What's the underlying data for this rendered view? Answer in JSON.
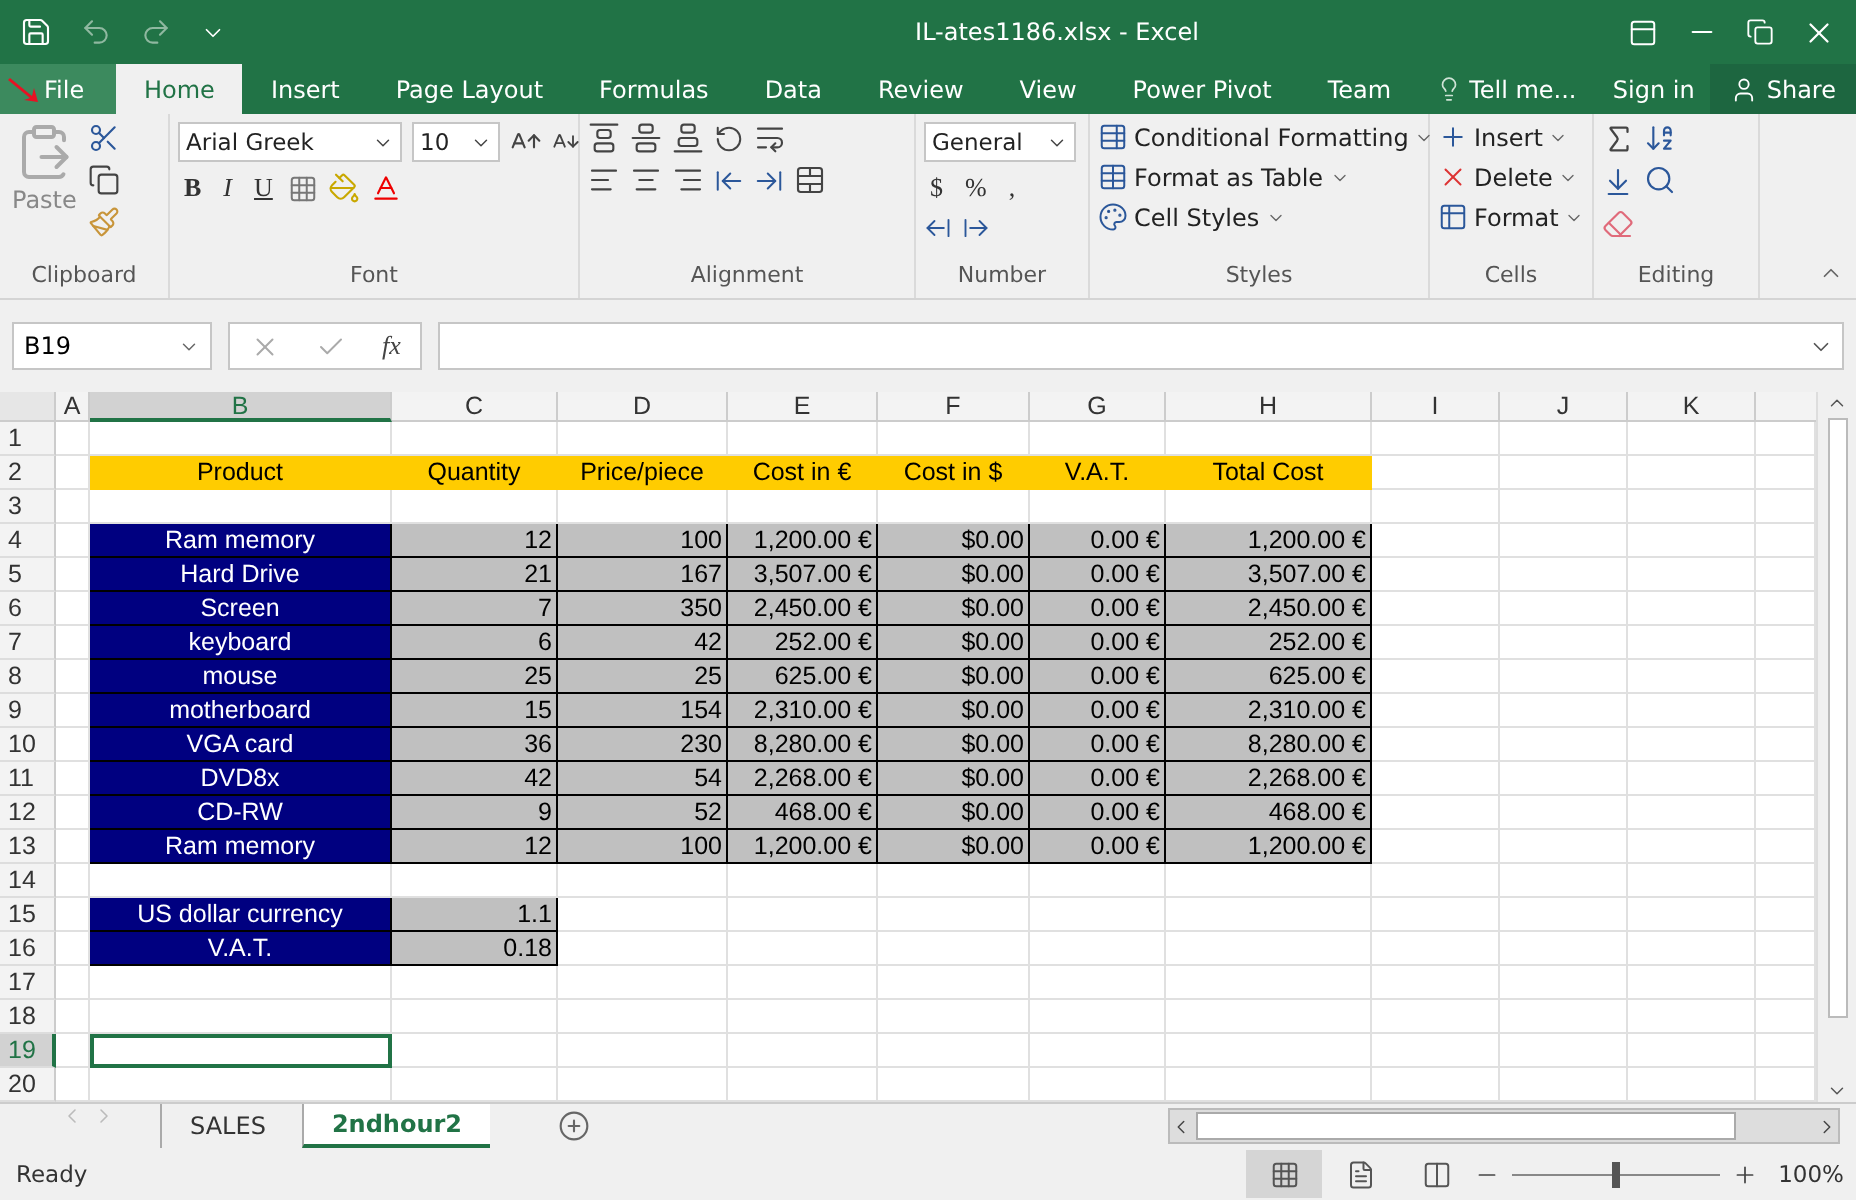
{
  "window": {
    "title": "IL-ates1186.xlsx - Excel"
  },
  "menu_tabs": [
    {
      "label": "File",
      "kind": "file",
      "selected": false
    },
    {
      "label": "Home",
      "kind": "tab",
      "selected": true
    },
    {
      "label": "Insert",
      "kind": "tab",
      "selected": false
    },
    {
      "label": "Page Layout",
      "kind": "tab",
      "selected": false
    },
    {
      "label": "Formulas",
      "kind": "tab",
      "selected": false
    },
    {
      "label": "Data",
      "kind": "tab",
      "selected": false
    },
    {
      "label": "Review",
      "kind": "tab",
      "selected": false
    },
    {
      "label": "View",
      "kind": "tab",
      "selected": false
    },
    {
      "label": "Power Pivot",
      "kind": "tab",
      "selected": false
    },
    {
      "label": "Team",
      "kind": "tab",
      "selected": false
    }
  ],
  "tell_me": "Tell me...",
  "sign_in": "Sign in",
  "share": "Share",
  "ribbon": {
    "paste": "Paste",
    "font_name": "Arial Greek",
    "font_size": "10",
    "font_buttons": [
      "B",
      "I",
      "U"
    ],
    "number_format": "General",
    "number_buttons": [
      "$",
      "%",
      ","
    ],
    "styles": [
      "Conditional Formatting",
      "Format as Table",
      "Cell Styles"
    ],
    "cells": [
      "Insert",
      "Delete",
      "Format"
    ],
    "groups": [
      "Clipboard",
      "Font",
      "Alignment",
      "Number",
      "Styles",
      "Cells",
      "Editing"
    ]
  },
  "formula_bar": {
    "name_box": "B19",
    "fx": "fx"
  },
  "sheet": {
    "columns": [
      {
        "label": "A",
        "selected": false
      },
      {
        "label": "B",
        "selected": true
      },
      {
        "label": "C",
        "selected": false
      },
      {
        "label": "D",
        "selected": false
      },
      {
        "label": "E",
        "selected": false
      },
      {
        "label": "F",
        "selected": false
      },
      {
        "label": "G",
        "selected": false
      },
      {
        "label": "H",
        "selected": false
      },
      {
        "label": "I",
        "selected": false
      },
      {
        "label": "J",
        "selected": false
      },
      {
        "label": "K",
        "selected": false
      }
    ],
    "rows": [
      {
        "number": "1",
        "selected": false,
        "cells": [
          {
            "kind": "empty"
          },
          {
            "kind": "empty"
          },
          {
            "kind": "empty"
          },
          {
            "kind": "empty"
          },
          {
            "kind": "empty"
          },
          {
            "kind": "empty"
          },
          {
            "kind": "empty"
          },
          {
            "kind": "empty"
          },
          {
            "kind": "empty"
          },
          {
            "kind": "empty"
          },
          {
            "kind": "empty"
          }
        ]
      },
      {
        "number": "2",
        "selected": false,
        "cells": [
          {
            "kind": "empty"
          },
          {
            "kind": "heading",
            "text": "Product"
          },
          {
            "kind": "heading",
            "text": "Quantity"
          },
          {
            "kind": "heading",
            "text": "Price/piece"
          },
          {
            "kind": "heading",
            "text": "Cost in €"
          },
          {
            "kind": "heading",
            "text": "Cost in $"
          },
          {
            "kind": "heading",
            "text": "V.A.T."
          },
          {
            "kind": "heading",
            "text": "Total Cost"
          },
          {
            "kind": "empty"
          },
          {
            "kind": "empty"
          },
          {
            "kind": "empty"
          }
        ]
      },
      {
        "number": "3",
        "selected": false,
        "cells": [
          {
            "kind": "empty"
          },
          {
            "kind": "empty"
          },
          {
            "kind": "empty"
          },
          {
            "kind": "empty"
          },
          {
            "kind": "empty"
          },
          {
            "kind": "empty"
          },
          {
            "kind": "empty"
          },
          {
            "kind": "empty"
          },
          {
            "kind": "empty"
          },
          {
            "kind": "empty"
          },
          {
            "kind": "empty"
          }
        ]
      },
      {
        "number": "4",
        "selected": false,
        "cells": [
          {
            "kind": "empty"
          },
          {
            "kind": "label",
            "text": "Ram memory"
          },
          {
            "kind": "value",
            "text": "12"
          },
          {
            "kind": "value",
            "text": "100"
          },
          {
            "kind": "value",
            "text": "1,200.00 €"
          },
          {
            "kind": "value",
            "text": "$0.00"
          },
          {
            "kind": "value",
            "text": "0.00 €"
          },
          {
            "kind": "value",
            "text": "1,200.00 €"
          },
          {
            "kind": "empty"
          },
          {
            "kind": "empty"
          },
          {
            "kind": "empty"
          }
        ]
      },
      {
        "number": "5",
        "selected": false,
        "cells": [
          {
            "kind": "empty"
          },
          {
            "kind": "label",
            "text": "Hard Drive"
          },
          {
            "kind": "value",
            "text": "21"
          },
          {
            "kind": "value",
            "text": "167"
          },
          {
            "kind": "value",
            "text": "3,507.00 €"
          },
          {
            "kind": "value",
            "text": "$0.00"
          },
          {
            "kind": "value",
            "text": "0.00 €"
          },
          {
            "kind": "value",
            "text": "3,507.00 €"
          },
          {
            "kind": "empty"
          },
          {
            "kind": "empty"
          },
          {
            "kind": "empty"
          }
        ]
      },
      {
        "number": "6",
        "selected": false,
        "cells": [
          {
            "kind": "empty"
          },
          {
            "kind": "label",
            "text": "Screen"
          },
          {
            "kind": "value",
            "text": "7"
          },
          {
            "kind": "value",
            "text": "350"
          },
          {
            "kind": "value",
            "text": "2,450.00 €"
          },
          {
            "kind": "value",
            "text": "$0.00"
          },
          {
            "kind": "value",
            "text": "0.00 €"
          },
          {
            "kind": "value",
            "text": "2,450.00 €"
          },
          {
            "kind": "empty"
          },
          {
            "kind": "empty"
          },
          {
            "kind": "empty"
          }
        ]
      },
      {
        "number": "7",
        "selected": false,
        "cells": [
          {
            "kind": "empty"
          },
          {
            "kind": "label",
            "text": "keyboard"
          },
          {
            "kind": "value",
            "text": "6"
          },
          {
            "kind": "value",
            "text": "42"
          },
          {
            "kind": "value",
            "text": "252.00 €"
          },
          {
            "kind": "value",
            "text": "$0.00"
          },
          {
            "kind": "value",
            "text": "0.00 €"
          },
          {
            "kind": "value",
            "text": "252.00 €"
          },
          {
            "kind": "empty"
          },
          {
            "kind": "empty"
          },
          {
            "kind": "empty"
          }
        ]
      },
      {
        "number": "8",
        "selected": false,
        "cells": [
          {
            "kind": "empty"
          },
          {
            "kind": "label",
            "text": "mouse"
          },
          {
            "kind": "value",
            "text": "25"
          },
          {
            "kind": "value",
            "text": "25"
          },
          {
            "kind": "value",
            "text": "625.00 €"
          },
          {
            "kind": "value",
            "text": "$0.00"
          },
          {
            "kind": "value",
            "text": "0.00 €"
          },
          {
            "kind": "value",
            "text": "625.00 €"
          },
          {
            "kind": "empty"
          },
          {
            "kind": "empty"
          },
          {
            "kind": "empty"
          }
        ]
      },
      {
        "number": "9",
        "selected": false,
        "cells": [
          {
            "kind": "empty"
          },
          {
            "kind": "label",
            "text": "motherboard"
          },
          {
            "kind": "value",
            "text": "15"
          },
          {
            "kind": "value",
            "text": "154"
          },
          {
            "kind": "value",
            "text": "2,310.00 €"
          },
          {
            "kind": "value",
            "text": "$0.00"
          },
          {
            "kind": "value",
            "text": "0.00 €"
          },
          {
            "kind": "value",
            "text": "2,310.00 €"
          },
          {
            "kind": "empty"
          },
          {
            "kind": "empty"
          },
          {
            "kind": "empty"
          }
        ]
      },
      {
        "number": "10",
        "selected": false,
        "cells": [
          {
            "kind": "empty"
          },
          {
            "kind": "label",
            "text": "VGA card"
          },
          {
            "kind": "value",
            "text": "36"
          },
          {
            "kind": "value",
            "text": "230"
          },
          {
            "kind": "value",
            "text": "8,280.00 €"
          },
          {
            "kind": "value",
            "text": "$0.00"
          },
          {
            "kind": "value",
            "text": "0.00 €"
          },
          {
            "kind": "value",
            "text": "8,280.00 €"
          },
          {
            "kind": "empty"
          },
          {
            "kind": "empty"
          },
          {
            "kind": "empty"
          }
        ]
      },
      {
        "number": "11",
        "selected": false,
        "cells": [
          {
            "kind": "empty"
          },
          {
            "kind": "label",
            "text": "DVD8x"
          },
          {
            "kind": "value",
            "text": "42"
          },
          {
            "kind": "value",
            "text": "54"
          },
          {
            "kind": "value",
            "text": "2,268.00 €"
          },
          {
            "kind": "value",
            "text": "$0.00"
          },
          {
            "kind": "value",
            "text": "0.00 €"
          },
          {
            "kind": "value",
            "text": "2,268.00 €"
          },
          {
            "kind": "empty"
          },
          {
            "kind": "empty"
          },
          {
            "kind": "empty"
          }
        ]
      },
      {
        "number": "12",
        "selected": false,
        "cells": [
          {
            "kind": "empty"
          },
          {
            "kind": "label",
            "text": "CD-RW"
          },
          {
            "kind": "value",
            "text": "9"
          },
          {
            "kind": "value",
            "text": "52"
          },
          {
            "kind": "value",
            "text": "468.00 €"
          },
          {
            "kind": "value",
            "text": "$0.00"
          },
          {
            "kind": "value",
            "text": "0.00 €"
          },
          {
            "kind": "value",
            "text": "468.00 €"
          },
          {
            "kind": "empty"
          },
          {
            "kind": "empty"
          },
          {
            "kind": "empty"
          }
        ]
      },
      {
        "number": "13",
        "selected": false,
        "cells": [
          {
            "kind": "empty"
          },
          {
            "kind": "label",
            "text": "Ram memory"
          },
          {
            "kind": "value",
            "text": "12"
          },
          {
            "kind": "value",
            "text": "100"
          },
          {
            "kind": "value",
            "text": "1,200.00 €"
          },
          {
            "kind": "value",
            "text": "$0.00"
          },
          {
            "kind": "value",
            "text": "0.00 €"
          },
          {
            "kind": "value",
            "text": "1,200.00 €"
          },
          {
            "kind": "empty"
          },
          {
            "kind": "empty"
          },
          {
            "kind": "empty"
          }
        ]
      },
      {
        "number": "14",
        "selected": false,
        "cells": [
          {
            "kind": "empty"
          },
          {
            "kind": "empty"
          },
          {
            "kind": "empty"
          },
          {
            "kind": "empty"
          },
          {
            "kind": "empty"
          },
          {
            "kind": "empty"
          },
          {
            "kind": "empty"
          },
          {
            "kind": "empty"
          },
          {
            "kind": "empty"
          },
          {
            "kind": "empty"
          },
          {
            "kind": "empty"
          }
        ]
      },
      {
        "number": "15",
        "selected": false,
        "cells": [
          {
            "kind": "empty"
          },
          {
            "kind": "label",
            "text": "US dollar currency"
          },
          {
            "kind": "value",
            "text": "1.1"
          },
          {
            "kind": "empty"
          },
          {
            "kind": "empty"
          },
          {
            "kind": "empty"
          },
          {
            "kind": "empty"
          },
          {
            "kind": "empty"
          },
          {
            "kind": "empty"
          },
          {
            "kind": "empty"
          },
          {
            "kind": "empty"
          }
        ]
      },
      {
        "number": "16",
        "selected": false,
        "cells": [
          {
            "kind": "empty"
          },
          {
            "kind": "label",
            "text": "V.A.T."
          },
          {
            "kind": "value",
            "text": "0.18"
          },
          {
            "kind": "empty"
          },
          {
            "kind": "empty"
          },
          {
            "kind": "empty"
          },
          {
            "kind": "empty"
          },
          {
            "kind": "empty"
          },
          {
            "kind": "empty"
          },
          {
            "kind": "empty"
          },
          {
            "kind": "empty"
          }
        ]
      },
      {
        "number": "17",
        "selected": false,
        "cells": [
          {
            "kind": "empty"
          },
          {
            "kind": "empty"
          },
          {
            "kind": "empty"
          },
          {
            "kind": "empty"
          },
          {
            "kind": "empty"
          },
          {
            "kind": "empty"
          },
          {
            "kind": "empty"
          },
          {
            "kind": "empty"
          },
          {
            "kind": "empty"
          },
          {
            "kind": "empty"
          },
          {
            "kind": "empty"
          }
        ]
      },
      {
        "number": "18",
        "selected": false,
        "cells": [
          {
            "kind": "empty"
          },
          {
            "kind": "empty"
          },
          {
            "kind": "empty"
          },
          {
            "kind": "empty"
          },
          {
            "kind": "empty"
          },
          {
            "kind": "empty"
          },
          {
            "kind": "empty"
          },
          {
            "kind": "empty"
          },
          {
            "kind": "empty"
          },
          {
            "kind": "empty"
          },
          {
            "kind": "empty"
          }
        ]
      },
      {
        "number": "19",
        "selected": true,
        "cells": [
          {
            "kind": "empty"
          },
          {
            "kind": "empty"
          },
          {
            "kind": "empty"
          },
          {
            "kind": "empty"
          },
          {
            "kind": "empty"
          },
          {
            "kind": "empty"
          },
          {
            "kind": "empty"
          },
          {
            "kind": "empty"
          },
          {
            "kind": "empty"
          },
          {
            "kind": "empty"
          },
          {
            "kind": "empty"
          }
        ]
      },
      {
        "number": "20",
        "selected": false,
        "cells": [
          {
            "kind": "empty"
          },
          {
            "kind": "empty"
          },
          {
            "kind": "empty"
          },
          {
            "kind": "empty"
          },
          {
            "kind": "empty"
          },
          {
            "kind": "empty"
          },
          {
            "kind": "empty"
          },
          {
            "kind": "empty"
          },
          {
            "kind": "empty"
          },
          {
            "kind": "empty"
          },
          {
            "kind": "empty"
          }
        ]
      }
    ]
  },
  "sheet_tabs": [
    {
      "label": "SALES",
      "selected": false
    },
    {
      "label": "2ndhour2",
      "selected": true
    }
  ],
  "status_bar": {
    "status": "Ready",
    "zoom": {
      "level": 0.5,
      "reading": "100%"
    }
  }
}
